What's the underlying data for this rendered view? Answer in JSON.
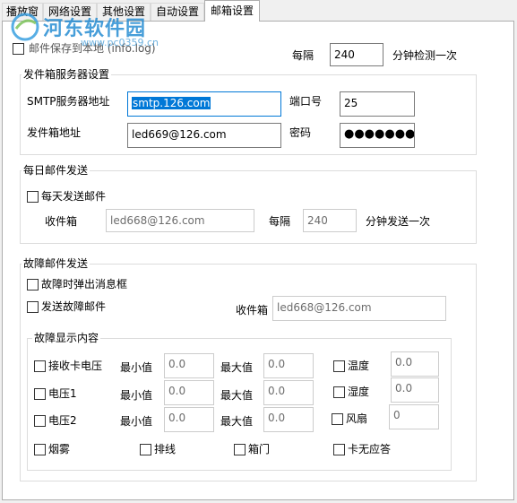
{
  "tabs": [
    {
      "label": "播放窗"
    },
    {
      "label": "网络设置"
    },
    {
      "label": "其他设置"
    },
    {
      "label": "自动设置"
    },
    {
      "label": "邮箱设置",
      "active": true
    }
  ],
  "watermark": {
    "title": "河东软件园",
    "url": "www.pc0359.cn"
  },
  "save_local": {
    "label": "邮件保存到本地 (info.log)",
    "checked": false
  },
  "check_interval": {
    "prefix": "每隔",
    "value": "240",
    "suffix": "分钟检测一次"
  },
  "server": {
    "legend": "发件箱服务器设置",
    "smtp_label": "SMTP服务器地址",
    "smtp_value": "smtp.126.com",
    "port_label": "端口号",
    "port_value": "25",
    "address_label": "发件箱地址",
    "address_value": "led669@126.com",
    "password_label": "密码",
    "password_value": "●●●●●●●●●●"
  },
  "daily": {
    "legend": "每日邮件发送",
    "send_label": "每天发送邮件",
    "send_checked": false,
    "recipient_label": "收件箱",
    "recipient_value": "led668@126.com",
    "interval_prefix": "每隔",
    "interval_value": "240",
    "interval_suffix": "分钟发送一次"
  },
  "fault": {
    "legend": "故障邮件发送",
    "popup_label": "故障时弹出消息框",
    "send_label": "发送故障邮件",
    "recipient_label": "收件箱",
    "recipient_value": "led668@126.com",
    "content": {
      "legend": "故障显示内容",
      "min_label": "最小值",
      "max_label": "最大值",
      "rows": [
        {
          "label": "接收卡电压",
          "min": "0.0",
          "max": "0.0",
          "right_label": "温度",
          "right_value": "0.0"
        },
        {
          "label": "电压1",
          "min": "0.0",
          "max": "0.0",
          "right_label": "湿度",
          "right_value": "0.0"
        },
        {
          "label": "电压2",
          "min": "0.0",
          "max": "0.0",
          "right_label": "风扇",
          "right_value": "0"
        }
      ],
      "bottom": [
        {
          "label": "烟雾"
        },
        {
          "label": "排线"
        },
        {
          "label": "箱门"
        },
        {
          "label": "卡无应答"
        }
      ]
    }
  },
  "colors": {
    "selection": "#0078d7",
    "border": "#dcdcdc",
    "focus_border": "#0078d7"
  }
}
